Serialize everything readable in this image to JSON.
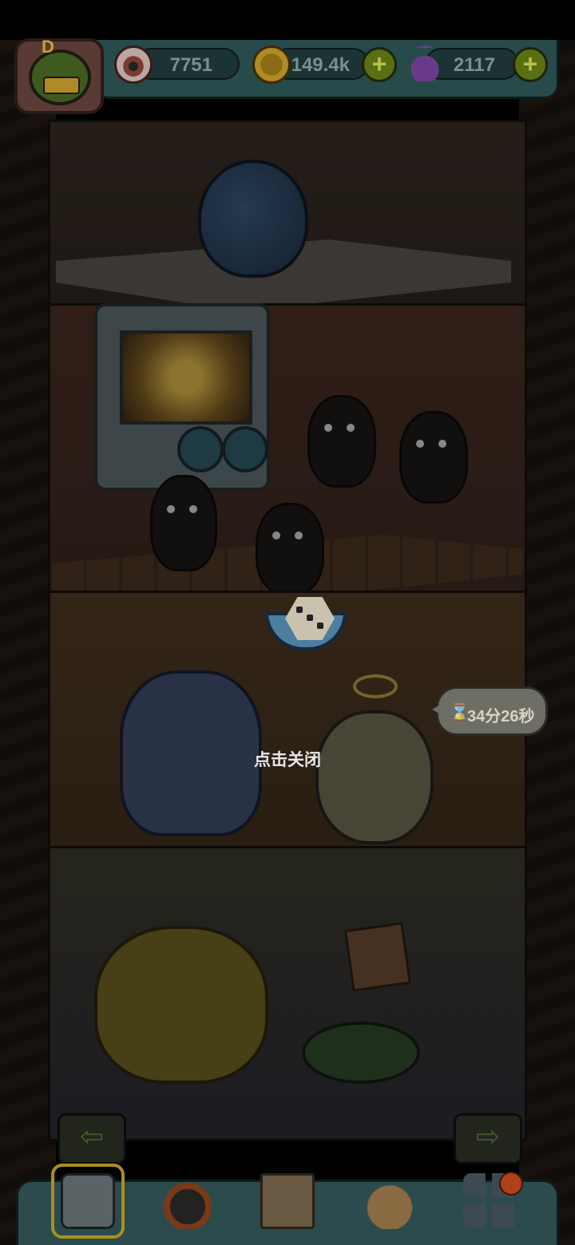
{
  "hud": {
    "eyeballs": "7751",
    "coins": "149.4k",
    "potions": "2117",
    "avatar_letter": "D",
    "plus_symbol": "+"
  },
  "timer": {
    "text": "34分26秒",
    "hourglass": "⌛"
  },
  "close_hint": "点击关闭",
  "nav": {
    "arrow_left": "⇦",
    "arrow_right": "⇨",
    "items": [
      "tower-icon",
      "summon-icon",
      "book-icon",
      "coin-bag-icon",
      "grid-menu-icon"
    ]
  },
  "colors": {
    "hud_bg": "#274a4b",
    "plus_green": "#5b6e14",
    "active_frame": "#a98f22",
    "badge_red": "#b0401a"
  }
}
